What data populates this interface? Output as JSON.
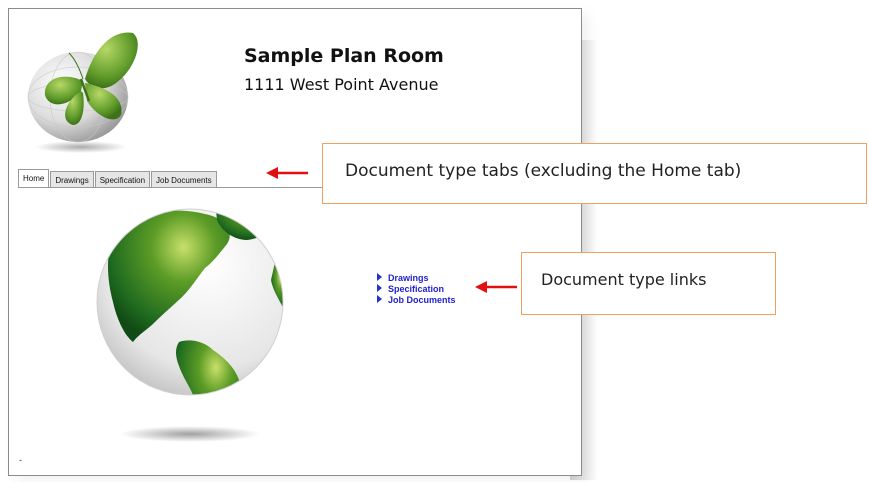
{
  "header": {
    "title": "Sample Plan Room",
    "address": "1111 West Point Avenue"
  },
  "tabs": [
    {
      "label": "Home",
      "active": true
    },
    {
      "label": "Drawings",
      "active": false
    },
    {
      "label": "Specification",
      "active": false
    },
    {
      "label": "Job Documents",
      "active": false
    }
  ],
  "doc_links": [
    {
      "label": "Drawings"
    },
    {
      "label": "Specification"
    },
    {
      "label": "Job Documents"
    }
  ],
  "footer_mark": "-",
  "callouts": {
    "tabs": "Document type tabs (excluding the Home tab)",
    "links": "Document type links"
  },
  "colors": {
    "link": "#2222cc",
    "callout_border": "#f0a060",
    "arrow": "#e01010",
    "logo_green": "#5f9b2a"
  },
  "icons": [
    "butterfly-logo-icon",
    "globe-image",
    "link-triangle-icon"
  ]
}
